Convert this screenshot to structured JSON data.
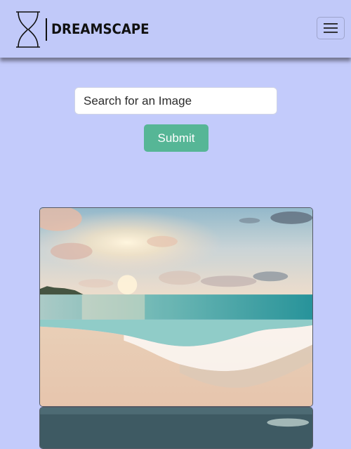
{
  "brand": {
    "name": "DREAMSCAPE",
    "logo_icon": "hourglass-icon"
  },
  "navbar": {
    "toggler_icon": "hamburger-menu-icon"
  },
  "search": {
    "placeholder": "Search for an Image",
    "value": ""
  },
  "submit": {
    "label": "Submit"
  },
  "results": [
    {
      "subject": "beach-sunset-photo"
    },
    {
      "subject": "ocean-photo"
    }
  ],
  "colors": {
    "page_background": "#c3cbfb",
    "navbar_background": "#c1c9f9",
    "submit_button": "#56b696",
    "text": "#111111"
  }
}
